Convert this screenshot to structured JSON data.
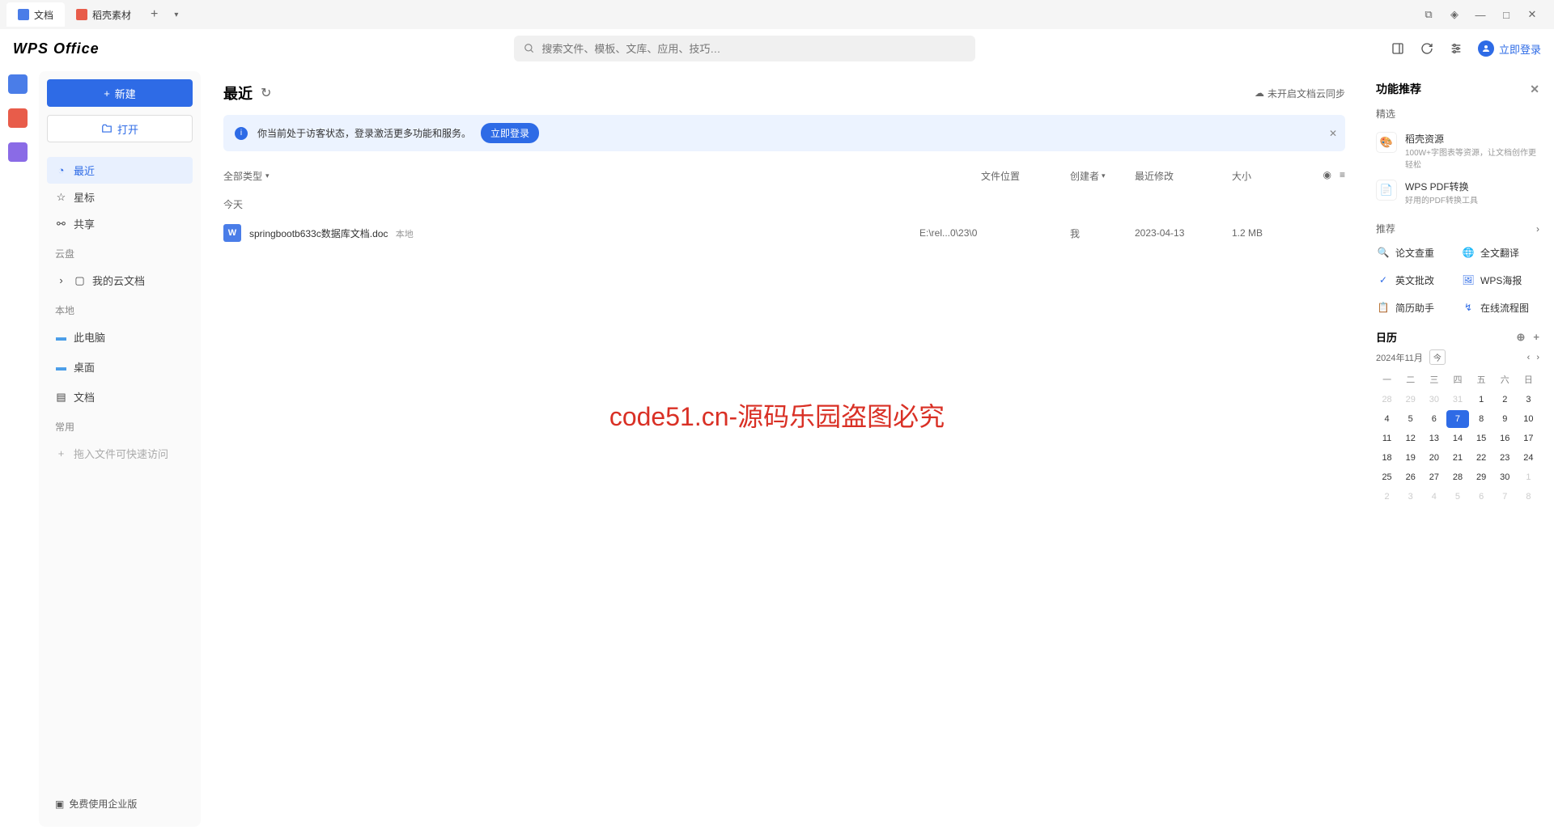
{
  "tabs": [
    {
      "label": "文档",
      "icon": "doc",
      "active": true
    },
    {
      "label": "稻壳素材",
      "icon": "dkz",
      "active": false
    }
  ],
  "logo": "WPS Office",
  "search": {
    "placeholder": "搜索文件、模板、文库、应用、技巧…"
  },
  "login": {
    "label": "立即登录"
  },
  "sidebar": {
    "new_btn": "新建",
    "open_btn": "打开",
    "recent": "最近",
    "starred": "星标",
    "shared": "共享",
    "cloud_heading": "云盘",
    "my_cloud": "我的云文档",
    "local_heading": "本地",
    "this_pc": "此电脑",
    "desktop": "桌面",
    "docs": "文档",
    "freq_heading": "常用",
    "drag_hint": "拖入文件可快速访问",
    "footer": "免费使用企业版"
  },
  "content": {
    "title": "最近",
    "sync_status": "未开启文档云同步",
    "banner_text": "你当前处于访客状态，登录激活更多功能和服务。",
    "banner_btn": "立即登录",
    "columns": {
      "type": "全部类型",
      "location": "文件位置",
      "creator": "创建者",
      "modified": "最近修改",
      "size": "大小"
    },
    "today": "今天",
    "files": [
      {
        "icon": "W",
        "name": "springbootb633c数据库文档.doc",
        "badge": "本地",
        "location": "E:\\rel...0\\23\\0",
        "creator": "我",
        "date": "2023-04-13",
        "size": "1.2 MB"
      }
    ]
  },
  "watermark": "code51.cn-源码乐园盗图必究",
  "rightpanel": {
    "title": "功能推荐",
    "featured_heading": "精选",
    "featured": [
      {
        "title": "稻壳资源",
        "desc": "100W+字图表等资源，让文档创作更轻松",
        "icon": "🎨"
      },
      {
        "title": "WPS PDF转换",
        "desc": "好用的PDF转换工具",
        "icon": "📄"
      }
    ],
    "recommend_heading": "推荐",
    "tools": [
      {
        "label": "论文查重",
        "icon": "🔍"
      },
      {
        "label": "全文翻译",
        "icon": "🌐"
      },
      {
        "label": "英文批改",
        "icon": "✓"
      },
      {
        "label": "WPS海报",
        "icon": "🖼"
      },
      {
        "label": "简历助手",
        "icon": "📋"
      },
      {
        "label": "在线流程图",
        "icon": "↯"
      }
    ],
    "calendar": {
      "title": "日历",
      "month": "2024年11月",
      "today_label": "今",
      "daynames": [
        "一",
        "二",
        "三",
        "四",
        "五",
        "六",
        "日"
      ],
      "weeks": [
        [
          {
            "d": 28,
            "o": true
          },
          {
            "d": 29,
            "o": true
          },
          {
            "d": 30,
            "o": true
          },
          {
            "d": 31,
            "o": true
          },
          {
            "d": 1
          },
          {
            "d": 2
          },
          {
            "d": 3
          }
        ],
        [
          {
            "d": 4
          },
          {
            "d": 5
          },
          {
            "d": 6
          },
          {
            "d": 7,
            "t": true
          },
          {
            "d": 8
          },
          {
            "d": 9
          },
          {
            "d": 10
          }
        ],
        [
          {
            "d": 11
          },
          {
            "d": 12
          },
          {
            "d": 13
          },
          {
            "d": 14
          },
          {
            "d": 15
          },
          {
            "d": 16
          },
          {
            "d": 17
          }
        ],
        [
          {
            "d": 18
          },
          {
            "d": 19
          },
          {
            "d": 20
          },
          {
            "d": 21
          },
          {
            "d": 22
          },
          {
            "d": 23
          },
          {
            "d": 24
          }
        ],
        [
          {
            "d": 25
          },
          {
            "d": 26
          },
          {
            "d": 27
          },
          {
            "d": 28
          },
          {
            "d": 29
          },
          {
            "d": 30
          },
          {
            "d": 1,
            "o": true
          }
        ],
        [
          {
            "d": 2,
            "o": true
          },
          {
            "d": 3,
            "o": true
          },
          {
            "d": 4,
            "o": true
          },
          {
            "d": 5,
            "o": true
          },
          {
            "d": 6,
            "o": true
          },
          {
            "d": 7,
            "o": true
          },
          {
            "d": 8,
            "o": true
          }
        ]
      ]
    }
  }
}
